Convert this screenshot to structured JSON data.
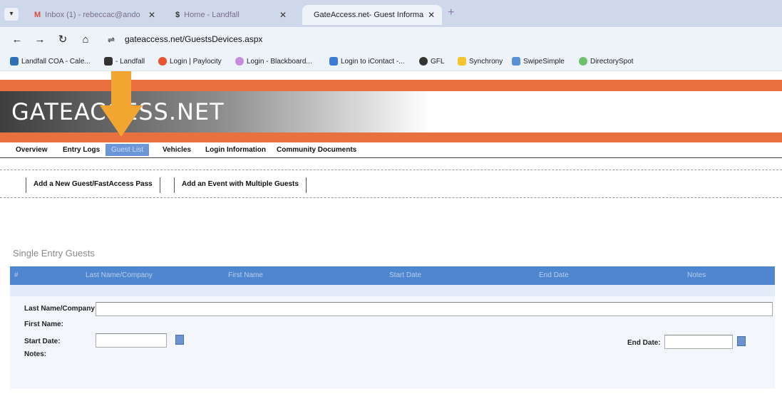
{
  "browser": {
    "tabs": [
      {
        "label": "Inbox (1) - rebeccac@ando"
      },
      {
        "label": "Home - Landfall"
      },
      {
        "label": "GateAccess.net- Guest Informa"
      }
    ],
    "new_tab": "+",
    "url": "gateaccess.net/GuestsDevices.aspx",
    "bookmarks": [
      {
        "label": "Landfall COA - Cale...",
        "color": "#2f6fb5"
      },
      {
        "label": "- Landfall",
        "color": "#333333"
      },
      {
        "label": "Login | Paylocity",
        "color": "#e8532c"
      },
      {
        "label": "Login - Blackboard...",
        "color": "#c98adf"
      },
      {
        "label": "Login to iContact -...",
        "color": "#3a7bd5"
      },
      {
        "label": "GFL",
        "color": "#333333"
      },
      {
        "label": "Synchrony",
        "color": "#f2c531"
      },
      {
        "label": "SwipeSimple",
        "color": "#5a8fd6"
      },
      {
        "label": "DirectorySpot",
        "color": "#6cc06c"
      }
    ]
  },
  "site": {
    "logo": "GATEACCESS.NET",
    "accent": "#e9713f",
    "nav": [
      "Overview",
      "Entry Logs",
      "Guest List",
      "Vehicles",
      "Login Information",
      "Community Documents"
    ],
    "actions": [
      "Add a New Guest/FastAccess Pass",
      "Add an Event with Multiple Guests"
    ]
  },
  "main": {
    "section_title": "Single Entry Guests",
    "columns": [
      "#",
      "Last Name/Company",
      "First Name",
      "Start Date",
      "End Date",
      "Notes"
    ],
    "form": {
      "last_name_label": "Last Name/Company:",
      "first_name_label": "First Name:",
      "start_date_label": "Start Date:",
      "notes_label": "Notes:",
      "end_date_label": "End Date:"
    }
  }
}
